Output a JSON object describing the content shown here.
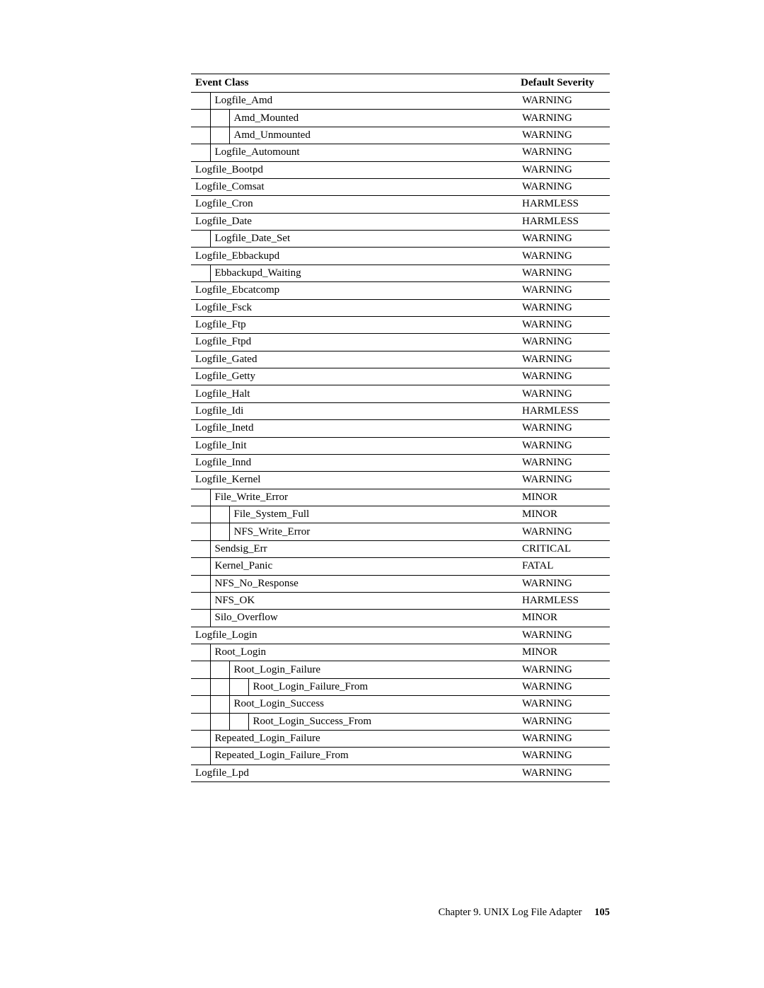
{
  "headers": {
    "event_class": "Event Class",
    "default_severity": "Default Severity"
  },
  "footer": {
    "chapter": "Chapter 9. UNIX Log File Adapter",
    "page_number": "105"
  },
  "rows": [
    {
      "indent": 1,
      "name": "Logfile_Amd",
      "severity": "WARNING"
    },
    {
      "indent": 2,
      "name": "Amd_Mounted",
      "severity": "WARNING"
    },
    {
      "indent": 2,
      "name": "Amd_Unmounted",
      "severity": "WARNING"
    },
    {
      "indent": 1,
      "name": "Logfile_Automount",
      "severity": "WARNING"
    },
    {
      "indent": 0,
      "name": "Logfile_Bootpd",
      "severity": "WARNING"
    },
    {
      "indent": 0,
      "name": "Logfile_Comsat",
      "severity": "WARNING"
    },
    {
      "indent": 0,
      "name": "Logfile_Cron",
      "severity": "HARMLESS"
    },
    {
      "indent": 0,
      "name": "Logfile_Date",
      "severity": "HARMLESS"
    },
    {
      "indent": 1,
      "name": "Logfile_Date_Set",
      "severity": "WARNING"
    },
    {
      "indent": 0,
      "name": "Logfile_Ebbackupd",
      "severity": "WARNING"
    },
    {
      "indent": 1,
      "name": "Ebbackupd_Waiting",
      "severity": "WARNING"
    },
    {
      "indent": 0,
      "name": "Logfile_Ebcatcomp",
      "severity": "WARNING"
    },
    {
      "indent": 0,
      "name": "Logfile_Fsck",
      "severity": "WARNING"
    },
    {
      "indent": 0,
      "name": "Logfile_Ftp",
      "severity": "WARNING"
    },
    {
      "indent": 0,
      "name": "Logfile_Ftpd",
      "severity": "WARNING"
    },
    {
      "indent": 0,
      "name": "Logfile_Gated",
      "severity": "WARNING"
    },
    {
      "indent": 0,
      "name": "Logfile_Getty",
      "severity": "WARNING"
    },
    {
      "indent": 0,
      "name": "Logfile_Halt",
      "severity": "WARNING"
    },
    {
      "indent": 0,
      "name": "Logfile_Idi",
      "severity": "HARMLESS"
    },
    {
      "indent": 0,
      "name": "Logfile_Inetd",
      "severity": "WARNING"
    },
    {
      "indent": 0,
      "name": "Logfile_Init",
      "severity": "WARNING"
    },
    {
      "indent": 0,
      "name": "Logfile_Innd",
      "severity": "WARNING"
    },
    {
      "indent": 0,
      "name": "Logfile_Kernel",
      "severity": "WARNING"
    },
    {
      "indent": 1,
      "name": "File_Write_Error",
      "severity": "MINOR"
    },
    {
      "indent": 2,
      "name": "File_System_Full",
      "severity": "MINOR"
    },
    {
      "indent": 2,
      "name": "NFS_Write_Error",
      "severity": "WARNING"
    },
    {
      "indent": 1,
      "name": "Sendsig_Err",
      "severity": "CRITICAL"
    },
    {
      "indent": 1,
      "name": "Kernel_Panic",
      "severity": "FATAL"
    },
    {
      "indent": 1,
      "name": "NFS_No_Response",
      "severity": "WARNING"
    },
    {
      "indent": 1,
      "name": "NFS_OK",
      "severity": "HARMLESS"
    },
    {
      "indent": 1,
      "name": "Silo_Overflow",
      "severity": "MINOR"
    },
    {
      "indent": 0,
      "name": "Logfile_Login",
      "severity": "WARNING"
    },
    {
      "indent": 1,
      "name": "Root_Login",
      "severity": "MINOR"
    },
    {
      "indent": 2,
      "name": "Root_Login_Failure",
      "severity": "WARNING"
    },
    {
      "indent": 3,
      "name": "Root_Login_Failure_From",
      "severity": "WARNING"
    },
    {
      "indent": 2,
      "name": "Root_Login_Success",
      "severity": "WARNING"
    },
    {
      "indent": 3,
      "name": "Root_Login_Success_From",
      "severity": "WARNING"
    },
    {
      "indent": 1,
      "name": "Repeated_Login_Failure",
      "severity": "WARNING"
    },
    {
      "indent": 1,
      "name": "Repeated_Login_Failure_From",
      "severity": "WARNING"
    },
    {
      "indent": 0,
      "name": "Logfile_Lpd",
      "severity": "WARNING"
    }
  ],
  "max_indent": 3
}
